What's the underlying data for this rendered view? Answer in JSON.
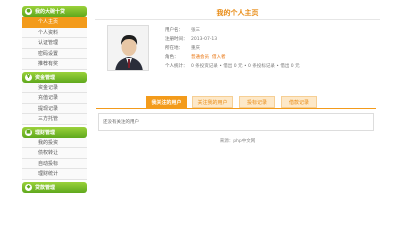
{
  "sidebar": {
    "sections": [
      {
        "icon": "user-icon",
        "title": "我的大碗十贷",
        "items": [
          "个人主页",
          "个人资料",
          "认证管理",
          "密码设置",
          "推荐有奖"
        ],
        "active": 0
      },
      {
        "icon": "money-icon",
        "title": "资金管理",
        "items": [
          "资金记录",
          "充值记录",
          "提现记录",
          "三方托管"
        ]
      },
      {
        "icon": "chart-icon",
        "title": "理财管理",
        "items": [
          "我的投资",
          "债权转让",
          "自动投标",
          "理财统计"
        ]
      },
      {
        "icon": "loan-icon",
        "title": "贷款管理",
        "items": []
      }
    ]
  },
  "main": {
    "title": "我的个人主页",
    "profile": {
      "rows": [
        {
          "label": "用户名：",
          "value": "张三"
        },
        {
          "label": "注册时间：",
          "value": "2013-07-13"
        },
        {
          "label": "所在地：",
          "value": "重庆"
        },
        {
          "label": "角色：",
          "links": [
            "普通会员",
            "借入者"
          ]
        },
        {
          "label": "个人统计：",
          "value": "0 条投资记录  •  借出 0 元  •  0 条投标记录  •  借出 0 元"
        }
      ]
    },
    "tabs": [
      "我关注的用户",
      "关注我的用户",
      "投标记录",
      "借款记录"
    ],
    "active_tab": 0,
    "panel_text": "还没有关注的用户",
    "footer": "来源：php中文网"
  },
  "colors": {
    "accent": "#f39b1b",
    "green": "#6cb62a",
    "title": "#e88a12"
  }
}
